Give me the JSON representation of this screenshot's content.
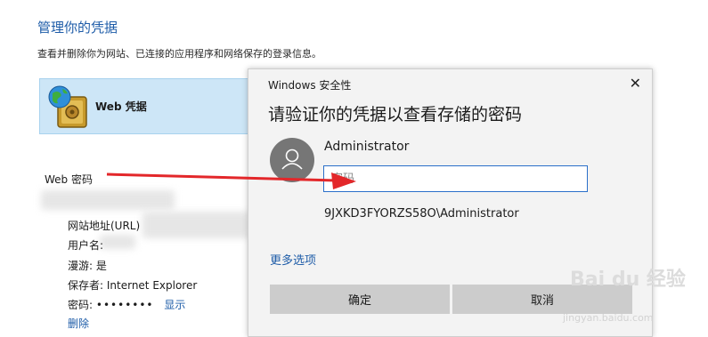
{
  "page": {
    "title": "管理你的凭据",
    "description": "查看并删除你为网站、已连接的应用程序和网络保存的登录信息。",
    "vault_label": "Web 凭据",
    "section_label": "Web 密码",
    "details": {
      "url_label": "网站地址(URL)",
      "username_label": "用户名:",
      "roaming": "漫游: 是",
      "saved_by": "保存者:  Internet Explorer",
      "password_label": "密码:",
      "password_mask": "••••••••",
      "show_link": "显示",
      "delete_link": "删除"
    }
  },
  "dialog": {
    "caption": "Windows 安全性",
    "close_glyph": "✕",
    "heading": "请验证你的凭据以查看存储的密码",
    "username": "Administrator",
    "password_placeholder": "密码",
    "domain_user": "9JXKD3FYORZS58O\\Administrator",
    "more_options": "更多选项",
    "ok_label": "确定",
    "cancel_label": "取消"
  },
  "watermark": {
    "logo": "Bai du 经验",
    "url": "jingyan.baidu.com"
  },
  "colors": {
    "accent": "#1e5ca8",
    "arrow": "#e3272a",
    "vault_bg": "#cde6f7",
    "button": "#cccccc"
  },
  "icons": [
    "globe-safe-icon",
    "user-avatar-icon",
    "close-icon"
  ]
}
